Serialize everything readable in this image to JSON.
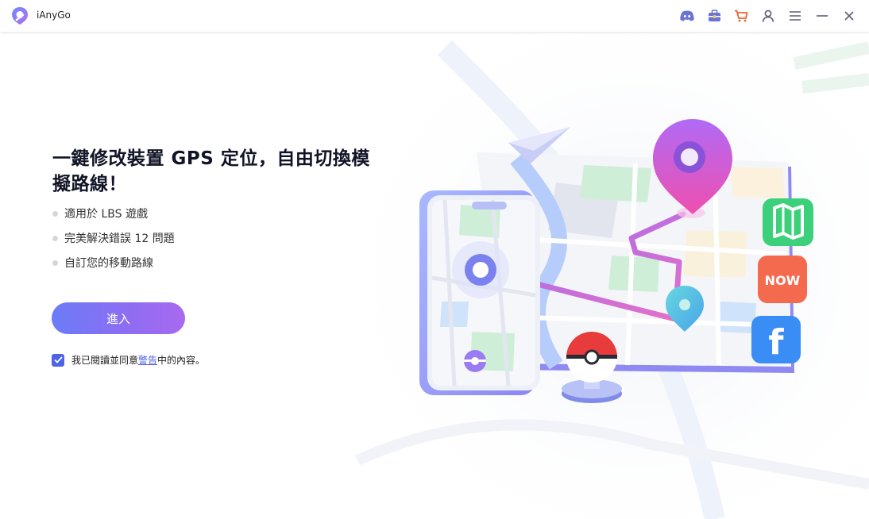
{
  "app": {
    "title": "iAnyGo"
  },
  "titlebar": {
    "icons": [
      "discord-icon",
      "toolbox-icon",
      "cart-icon",
      "account-icon",
      "menu-icon",
      "minimize-icon",
      "close-icon"
    ],
    "cart_color": "#f0622e",
    "icon_color": "#5b5f72"
  },
  "main": {
    "headline_line1": "一鍵修改裝置 GPS 定位，自由切換模",
    "headline_line2": "擬路線！",
    "bullets": [
      "適用於 LBS 遊戲",
      "完美解決錯誤 12 問題",
      "自訂您的移動路線"
    ],
    "enter_label": "進入",
    "agree_prefix": "我已閱讀並同意",
    "agree_link": "警告",
    "agree_suffix": "中的內容。",
    "agree_checked": true,
    "accent": "#4f63e8"
  },
  "illustration": {
    "badges": [
      "map-app-icon",
      "now-app-icon",
      "facebook-app-icon"
    ],
    "now_label": "NOW",
    "facebook_label": "f"
  }
}
